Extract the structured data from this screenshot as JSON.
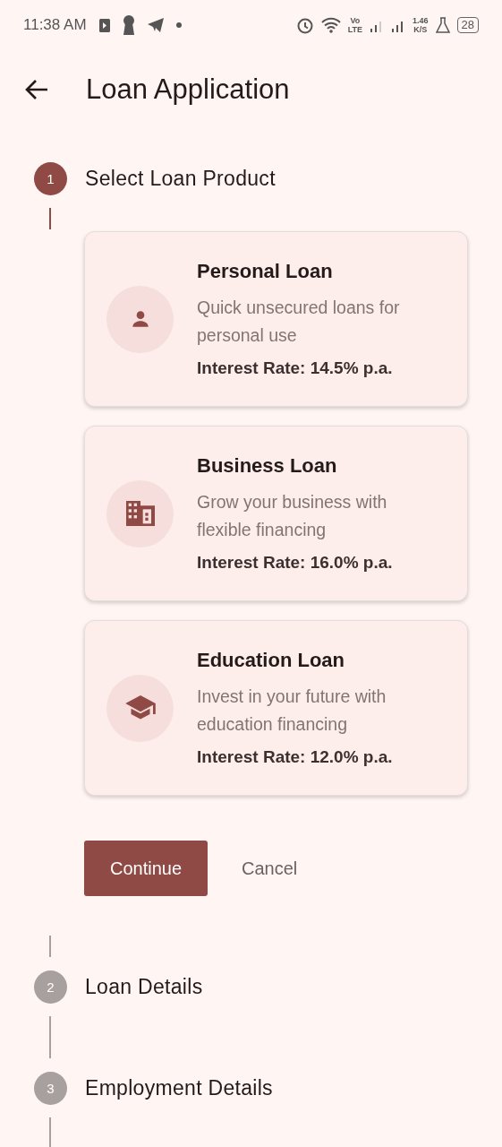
{
  "status_bar": {
    "time": "11:38 AM",
    "network_label_top": "Vo",
    "network_label_bottom": "LTE",
    "speed_value": "1.46",
    "speed_unit": "K/S",
    "battery": "28"
  },
  "app_bar": {
    "title": "Loan Application"
  },
  "steps": [
    {
      "number": "1",
      "title": "Select Loan Product",
      "selected": true,
      "products": [
        {
          "kind": "person",
          "title": "Personal Loan",
          "description": "Quick unsecured loans for personal use",
          "rate": "Interest Rate: 14.5% p.a."
        },
        {
          "kind": "business",
          "title": "Business Loan",
          "description": "Grow your business with flexible financing",
          "rate": "Interest Rate: 16.0% p.a."
        },
        {
          "kind": "education",
          "title": "Education Loan",
          "description": "Invest in your future with education financing",
          "rate": "Interest Rate: 12.0% p.a."
        }
      ],
      "actions": {
        "primary": "Continue",
        "secondary": "Cancel"
      }
    },
    {
      "number": "2",
      "title": "Loan Details",
      "selected": false
    },
    {
      "number": "3",
      "title": "Employment Details",
      "selected": false
    }
  ]
}
